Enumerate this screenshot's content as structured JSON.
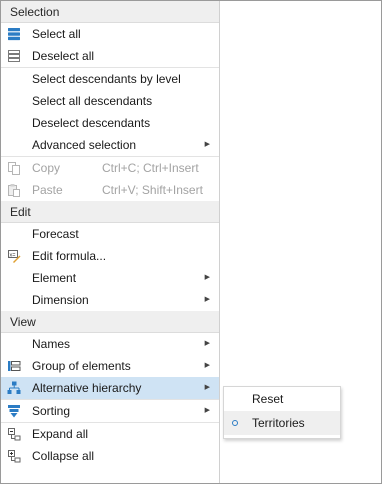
{
  "colors": {
    "accent": "#2b7cc4",
    "highlight": "#cfe3f4",
    "section_bg": "#efefef",
    "disabled_text": "#a3a3a3"
  },
  "sections": {
    "selection": "Selection",
    "edit": "Edit",
    "view": "View"
  },
  "items": {
    "select_all": "Select all",
    "deselect_all": "Deselect all",
    "select_descendants_by_level": "Select descendants by level",
    "select_all_descendants": "Select all descendants",
    "deselect_descendants": "Deselect descendants",
    "advanced_selection": "Advanced selection",
    "copy": "Copy",
    "copy_shortcut": "Ctrl+C; Ctrl+Insert",
    "paste": "Paste",
    "paste_shortcut": "Ctrl+V; Shift+Insert",
    "forecast": "Forecast",
    "edit_formula": "Edit formula...",
    "element": "Element",
    "dimension": "Dimension",
    "names": "Names",
    "group_of_elements": "Group of elements",
    "alternative_hierarchy": "Alternative hierarchy",
    "sorting": "Sorting",
    "expand_all": "Expand all",
    "collapse_all": "Collapse all"
  },
  "submenu": {
    "reset": "Reset",
    "territories": "Territories",
    "selected": "Territories"
  },
  "icons": {
    "select_all": "stack-filled-icon",
    "deselect_all": "stack-outline-icon",
    "copy": "copy-icon",
    "paste": "paste-icon",
    "edit_formula": "formula-icon",
    "group_of_elements": "group-icon",
    "alternative_hierarchy": "hierarchy-icon",
    "sorting": "sort-icon",
    "expand_all": "expand-icon",
    "collapse_all": "collapse-icon",
    "submenu_arrow": "chevron-right-icon",
    "radio": "radio-dot-icon"
  }
}
